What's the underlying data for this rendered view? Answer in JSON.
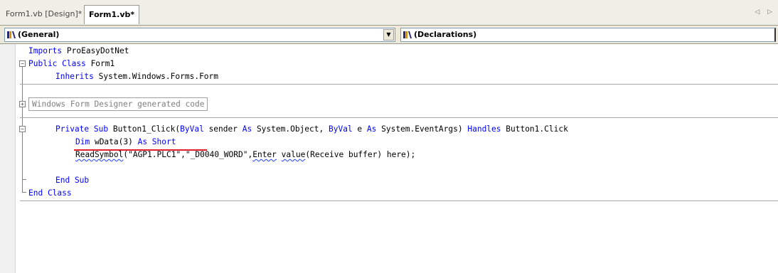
{
  "tabs": {
    "design_tab": "Form1.vb [Design]*",
    "code_tab": "Form1.vb*",
    "nav_arrows": "◁ ▷"
  },
  "combos": {
    "left_value": "(General)",
    "right_value": "(Declarations)",
    "dropdown_glyph": "▼"
  },
  "code": {
    "l1_kw": "Imports",
    "l1_rest": " ProEasyDotNet",
    "l2_kw": "Public Class",
    "l2_rest": " Form1",
    "l3_kw": "Inherits",
    "l3_rest": " System.Windows.Forms.Form",
    "region": "Windows Form Designer generated code",
    "l5_kw1": "Private Sub",
    "l5_a": " Button1_Click(",
    "l5_kw2": "ByVal",
    "l5_b": " sender ",
    "l5_kw3": "As",
    "l5_c": " System.Object, ",
    "l5_kw4": "ByVal",
    "l5_d": " e ",
    "l5_kw5": "As",
    "l5_e": " System.EventArgs) ",
    "l5_kw6": "Handles",
    "l5_f": " Button1.Click",
    "l6_kw1": "Dim",
    "l6_a": " wData(3) ",
    "l6_kw2": "As Short",
    "l7_sq1": "ReadSymbol",
    "l7_a": "(\"AGP1.PLC1\",\"_D0040_WORD\",",
    "l7_sq2": "Enter",
    "l7_b": " ",
    "l7_sq3": "value",
    "l7_c": "(Receive buffer) here);",
    "l8_kw": "End Sub",
    "l9_kw": "End Class"
  },
  "outline": {
    "collapse_glyph": "−",
    "expand_glyph": "+"
  },
  "colors": {
    "keyword": "#0000ff",
    "annotation_underline": "#e0202c"
  }
}
